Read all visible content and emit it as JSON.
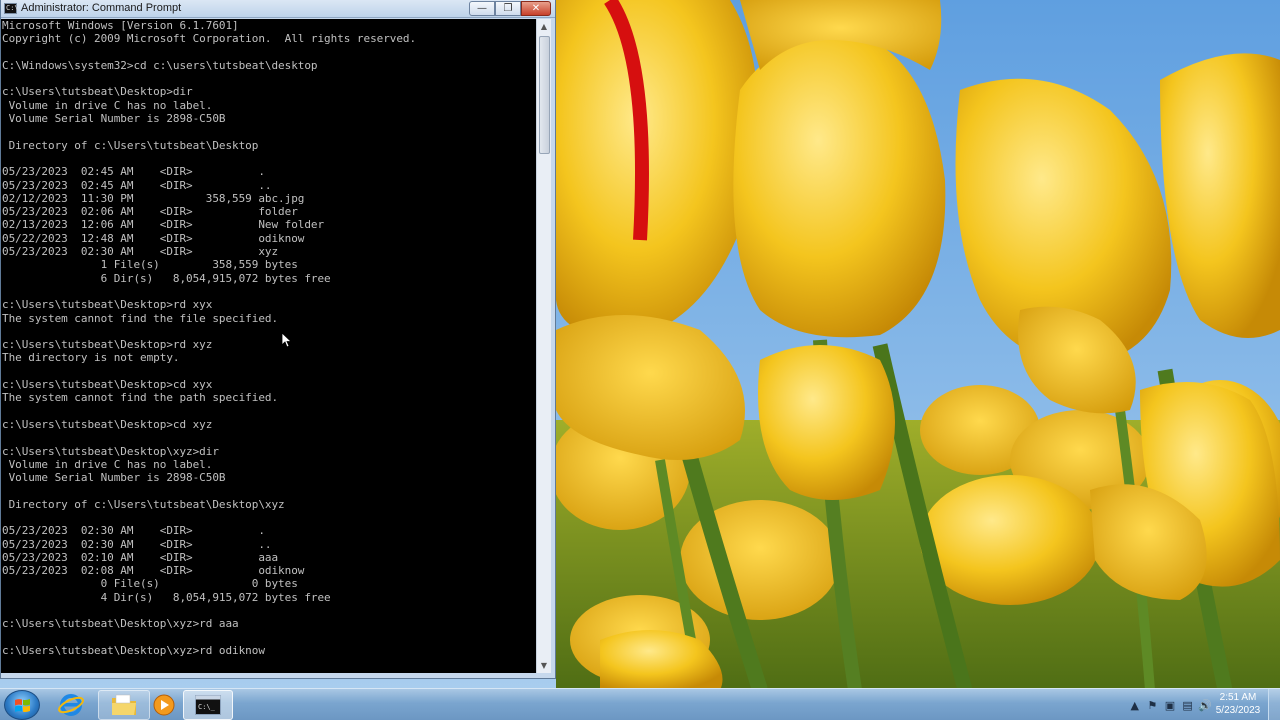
{
  "window": {
    "title": "Administrator: Command Prompt",
    "icon_label": "C:\\",
    "minimize_glyph": "—",
    "maximize_glyph": "❐",
    "close_glyph": "✕"
  },
  "console": {
    "lines": [
      "Microsoft Windows [Version 6.1.7601]",
      "Copyright (c) 2009 Microsoft Corporation.  All rights reserved.",
      "",
      "C:\\Windows\\system32>cd c:\\users\\tutsbeat\\desktop",
      "",
      "c:\\Users\\tutsbeat\\Desktop>dir",
      " Volume in drive C has no label.",
      " Volume Serial Number is 2898-C50B",
      "",
      " Directory of c:\\Users\\tutsbeat\\Desktop",
      "",
      "05/23/2023  02:45 AM    <DIR>          .",
      "05/23/2023  02:45 AM    <DIR>          ..",
      "02/12/2023  11:30 PM           358,559 abc.jpg",
      "05/23/2023  02:06 AM    <DIR>          folder",
      "02/13/2023  12:06 AM    <DIR>          New folder",
      "05/22/2023  12:48 AM    <DIR>          odiknow",
      "05/23/2023  02:30 AM    <DIR>          xyz",
      "               1 File(s)        358,559 bytes",
      "               6 Dir(s)   8,054,915,072 bytes free",
      "",
      "c:\\Users\\tutsbeat\\Desktop>rd xyx",
      "The system cannot find the file specified.",
      "",
      "c:\\Users\\tutsbeat\\Desktop>rd xyz",
      "The directory is not empty.",
      "",
      "c:\\Users\\tutsbeat\\Desktop>cd xyx",
      "The system cannot find the path specified.",
      "",
      "c:\\Users\\tutsbeat\\Desktop>cd xyz",
      "",
      "c:\\Users\\tutsbeat\\Desktop\\xyz>dir",
      " Volume in drive C has no label.",
      " Volume Serial Number is 2898-C50B",
      "",
      " Directory of c:\\Users\\tutsbeat\\Desktop\\xyz",
      "",
      "05/23/2023  02:30 AM    <DIR>          .",
      "05/23/2023  02:30 AM    <DIR>          ..",
      "05/23/2023  02:10 AM    <DIR>          aaa",
      "05/23/2023  02:08 AM    <DIR>          odiknow",
      "               0 File(s)              0 bytes",
      "               4 Dir(s)   8,054,915,072 bytes free",
      "",
      "c:\\Users\\tutsbeat\\Desktop\\xyz>rd aaa",
      "",
      "c:\\Users\\tutsbeat\\Desktop\\xyz>rd odiknow"
    ],
    "text_color": "#c0c0c0",
    "background": "#000000"
  },
  "scrollbar": {
    "up_glyph": "▲",
    "down_glyph": "▼",
    "position": 0.06
  },
  "taskbar": {
    "apps": [
      "internet-explorer",
      "windows-explorer",
      "windows-media-player",
      "command-prompt"
    ],
    "cmd_label": "C:\\_",
    "tray_icons": [
      "action-center-icon",
      "network-icon",
      "power-icon",
      "device-icon",
      "volume-icon"
    ],
    "tray_glyphs": [
      "▲",
      "⚑",
      "▣",
      "▤",
      "🔊"
    ],
    "clock_time": "2:51 AM",
    "clock_date": "5/23/2023"
  },
  "desktop": {
    "wallpaper": "yellow tulips",
    "sky_color": "#6ea9df",
    "petal_color": "#f3c21b",
    "stem_color": "#4f7a1e"
  }
}
